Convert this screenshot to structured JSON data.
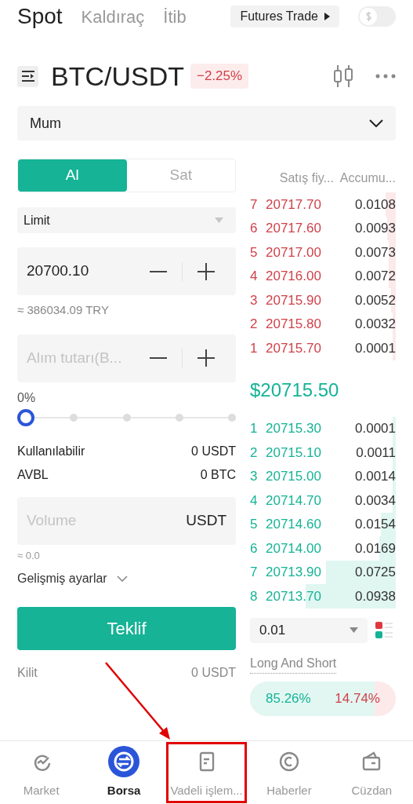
{
  "top_tabs": [
    {
      "label": "Spot",
      "selected": true
    },
    {
      "label": "Kaldıraç",
      "selected": false
    },
    {
      "label": "İtib",
      "selected": false
    }
  ],
  "futures_button": {
    "label": "Futures Trade"
  },
  "currency_toggle": {
    "on": false
  },
  "pair": {
    "name": "BTC/USDT",
    "change": "−2.25%"
  },
  "chart_type": {
    "value": "Mum"
  },
  "side_tabs": [
    {
      "label": "Al",
      "selected": true
    },
    {
      "label": "Sat",
      "selected": false
    }
  ],
  "order_type": {
    "value": "Limit"
  },
  "price_field": {
    "value": "20700.10"
  },
  "price_estimate": "≈ 386034.09 TRY",
  "amount_field": {
    "placeholder": "Alım tutarı(B..."
  },
  "percent": {
    "label": "0%",
    "level": 0
  },
  "balances": [
    {
      "label": "Kullanılabilir",
      "value": "0 USDT"
    },
    {
      "label": "AVBL",
      "value": "0 BTC"
    }
  ],
  "volume_field": {
    "placeholder": "Volume",
    "unit": "USDT"
  },
  "volume_estimate": "≈ 0.0",
  "advanced": {
    "label": "Gelişmiş ayarlar",
    "expanded": false
  },
  "submit": {
    "label": "Teklif"
  },
  "lock": {
    "label": "Kilit",
    "value": "0 USDT"
  },
  "order_book": {
    "columns": [
      "Satış fiy...",
      "Accumu..."
    ],
    "asks": [
      {
        "index": "7",
        "price": "20717.70",
        "amount": "0.0108"
      },
      {
        "index": "6",
        "price": "20717.60",
        "amount": "0.0093"
      },
      {
        "index": "5",
        "price": "20717.00",
        "amount": "0.0073"
      },
      {
        "index": "4",
        "price": "20716.00",
        "amount": "0.0072"
      },
      {
        "index": "3",
        "price": "20715.90",
        "amount": "0.0052"
      },
      {
        "index": "2",
        "price": "20715.80",
        "amount": "0.0032"
      },
      {
        "index": "1",
        "price": "20715.70",
        "amount": "0.0001"
      }
    ],
    "last_price": "$20715.50",
    "bids": [
      {
        "index": "1",
        "price": "20715.30",
        "amount": "0.0001"
      },
      {
        "index": "2",
        "price": "20715.10",
        "amount": "0.0011"
      },
      {
        "index": "3",
        "price": "20715.00",
        "amount": "0.0014"
      },
      {
        "index": "4",
        "price": "20714.70",
        "amount": "0.0034"
      },
      {
        "index": "5",
        "price": "20714.60",
        "amount": "0.0154"
      },
      {
        "index": "6",
        "price": "20714.00",
        "amount": "0.0169"
      },
      {
        "index": "7",
        "price": "20713.90",
        "amount": "0.0725"
      },
      {
        "index": "8",
        "price": "20713.70",
        "amount": "0.0938"
      }
    ],
    "precision": "0.01"
  },
  "long_short": {
    "title": "Long And Short",
    "long": "85.26%",
    "short": "14.74%",
    "level": 0.8526
  },
  "nav": [
    {
      "label": "Market",
      "selected": false,
      "highlighted": false
    },
    {
      "label": "Borsa",
      "selected": true,
      "highlighted": false
    },
    {
      "label": "Vadeli işlem...",
      "selected": false,
      "highlighted": true
    },
    {
      "label": "Haberler",
      "selected": false,
      "highlighted": false
    },
    {
      "label": "Cüzdan",
      "selected": false,
      "highlighted": false
    }
  ]
}
